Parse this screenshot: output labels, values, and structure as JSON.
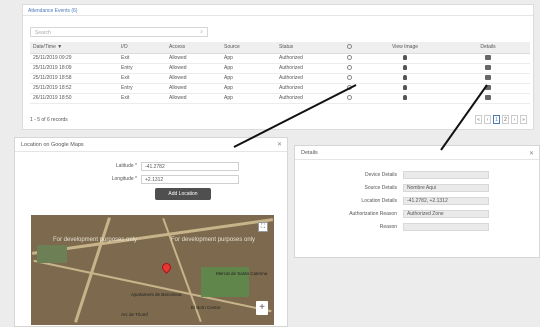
{
  "attendance": {
    "title": "Attendance Events (6)",
    "search_placeholder": "Search",
    "columns": [
      "Date/Time",
      "I/O",
      "Access",
      "Source",
      "Status",
      "GEO",
      "View Image",
      "Details"
    ],
    "rows": [
      {
        "datetime": "25/11/2019 09:29",
        "io": "Exit",
        "access": "Allowed",
        "source": "App",
        "status": "Authorized"
      },
      {
        "datetime": "25/11/2019 18:09",
        "io": "Entry",
        "access": "Allowed",
        "source": "App",
        "status": "Authorized"
      },
      {
        "datetime": "25/11/2019 18:58",
        "io": "Exit",
        "access": "Allowed",
        "source": "App",
        "status": "Authorized"
      },
      {
        "datetime": "25/11/2019 18:52",
        "io": "Entry",
        "access": "Allowed",
        "source": "App",
        "status": "Authorized"
      },
      {
        "datetime": "26/11/2019 18:50",
        "io": "Exit",
        "access": "Allowed",
        "source": "App",
        "status": "Authorized"
      }
    ],
    "records_text": "1 - 5 of 6 records",
    "pager": [
      "«",
      "‹",
      "1",
      "2",
      "›",
      "»"
    ]
  },
  "map_dialog": {
    "title": "Location on Google Maps",
    "latitude_label": "Latitude *",
    "latitude_value": "-41.2782",
    "longitude_label": "Longitude *",
    "longitude_value": "+2.1312",
    "add_button": "Add Location",
    "dev_text": "For development purposes only",
    "places": [
      "Ajuntament de Barcelona",
      "Mercat de Santa Caterina",
      "El Born Centre",
      "Arc de Triomf"
    ],
    "zoom_in": "+",
    "fullscreen": "⛶"
  },
  "details_dialog": {
    "title": "Details",
    "fields": [
      {
        "label": "Device Details",
        "value": ""
      },
      {
        "label": "Source Details",
        "value": "Nombre Aqui"
      },
      {
        "label": "Location Details",
        "value": "-41.2782, +2.1312"
      },
      {
        "label": "Authorization Reason",
        "value": "Authorized Zone"
      },
      {
        "label": "Reason",
        "value": ""
      }
    ]
  },
  "colors": {
    "accent": "#4a79b8",
    "button": "#4f4f4f",
    "pin": "#e53935"
  }
}
